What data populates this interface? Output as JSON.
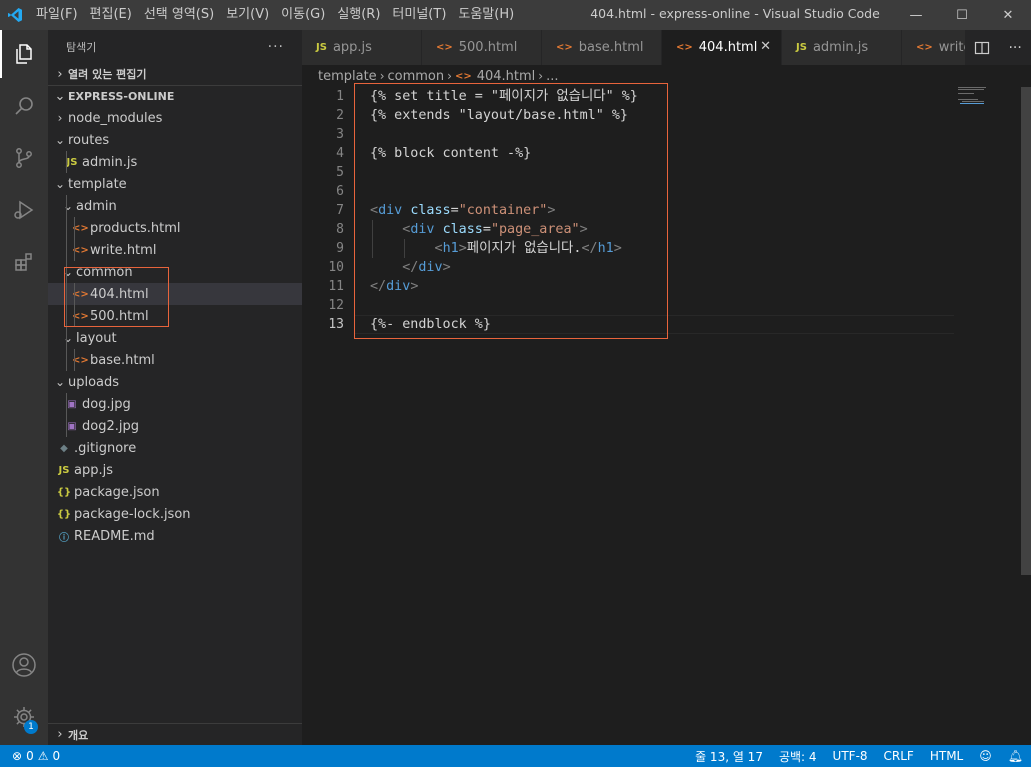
{
  "window": {
    "title": "404.html - express-online - Visual Studio Code",
    "menu": [
      "파일(F)",
      "편집(E)",
      "선택 영역(S)",
      "보기(V)",
      "이동(G)",
      "실행(R)",
      "터미널(T)",
      "도움말(H)"
    ],
    "controls": {
      "minimize": "—",
      "maximize": "☐",
      "close": "✕"
    }
  },
  "activity_bar": {
    "icons": [
      "files-icon",
      "search-icon",
      "source-control-icon",
      "run-debug-icon",
      "extensions-icon",
      "account-icon",
      "settings-icon"
    ],
    "settings_badge": "1"
  },
  "explorer": {
    "header": "탐색기",
    "more": "···",
    "open_editors": "열려 있는 편집기",
    "workspace": "EXPRESS-ONLINE",
    "outline": "개요",
    "tree": [
      {
        "label": "node_modules",
        "kind": "folder",
        "expanded": false
      },
      {
        "label": "routes",
        "kind": "folder",
        "expanded": true
      },
      {
        "label": "admin.js",
        "kind": "js"
      },
      {
        "label": "template",
        "kind": "folder",
        "expanded": true
      },
      {
        "label": "admin",
        "kind": "folder",
        "expanded": true
      },
      {
        "label": "products.html",
        "kind": "html"
      },
      {
        "label": "write.html",
        "kind": "html"
      },
      {
        "label": "common",
        "kind": "folder",
        "expanded": true
      },
      {
        "label": "404.html",
        "kind": "html",
        "active": true
      },
      {
        "label": "500.html",
        "kind": "html"
      },
      {
        "label": "layout",
        "kind": "folder",
        "expanded": true
      },
      {
        "label": "base.html",
        "kind": "html"
      },
      {
        "label": "uploads",
        "kind": "folder",
        "expanded": true
      },
      {
        "label": "dog.jpg",
        "kind": "image"
      },
      {
        "label": "dog2.jpg",
        "kind": "image"
      },
      {
        "label": ".gitignore",
        "kind": "git"
      },
      {
        "label": "app.js",
        "kind": "js"
      },
      {
        "label": "package.json",
        "kind": "json"
      },
      {
        "label": "package-lock.json",
        "kind": "json"
      },
      {
        "label": "README.md",
        "kind": "info"
      }
    ],
    "icon_glyphs": {
      "js": "JS",
      "html": "<>",
      "json": "{}",
      "image": "▣",
      "git": "◆",
      "info": "ⓘ"
    }
  },
  "tabs": [
    {
      "label": "app.js",
      "icon": "JS",
      "active": false
    },
    {
      "label": "500.html",
      "icon": "<>",
      "active": false
    },
    {
      "label": "base.html",
      "icon": "<>",
      "active": false
    },
    {
      "label": "404.html",
      "icon": "<>",
      "active": true,
      "close": "✕"
    },
    {
      "label": "admin.js",
      "icon": "JS",
      "active": false
    },
    {
      "label": "write",
      "icon": "<>",
      "active": false
    }
  ],
  "breadcrumb": {
    "parts": [
      "template",
      "common",
      "404.html",
      "..."
    ],
    "separator": "›"
  },
  "editor": {
    "line_numbers": [
      "1",
      "2",
      "3",
      "4",
      "5",
      "6",
      "7",
      "8",
      "9",
      "10",
      "11",
      "12",
      "13"
    ],
    "lines": [
      [
        {
          "t": "{% set title = \"페이지가 없습니다\" %}",
          "c": "plain"
        }
      ],
      [
        {
          "t": "{% extends \"layout/base.html\" %}",
          "c": "plain"
        }
      ],
      [
        {
          "t": "",
          "c": "plain"
        }
      ],
      [
        {
          "t": "{% block content -%}",
          "c": "plain"
        }
      ],
      [
        {
          "t": "",
          "c": "plain"
        }
      ],
      [
        {
          "t": "",
          "c": "plain"
        }
      ],
      [
        {
          "t": "<",
          "c": "br"
        },
        {
          "t": "div",
          "c": "tag"
        },
        {
          "t": " ",
          "c": "plain"
        },
        {
          "t": "class",
          "c": "attr"
        },
        {
          "t": "=",
          "c": "plain"
        },
        {
          "t": "\"container\"",
          "c": "str"
        },
        {
          "t": ">",
          "c": "br"
        }
      ],
      [
        {
          "t": "    ",
          "c": "plain"
        },
        {
          "t": "<",
          "c": "br"
        },
        {
          "t": "div",
          "c": "tag"
        },
        {
          "t": " ",
          "c": "plain"
        },
        {
          "t": "class",
          "c": "attr"
        },
        {
          "t": "=",
          "c": "plain"
        },
        {
          "t": "\"page_area\"",
          "c": "str"
        },
        {
          "t": ">",
          "c": "br"
        }
      ],
      [
        {
          "t": "        ",
          "c": "plain"
        },
        {
          "t": "<",
          "c": "br"
        },
        {
          "t": "h1",
          "c": "tag"
        },
        {
          "t": ">",
          "c": "br"
        },
        {
          "t": "페이지가 없습니다.",
          "c": "plain"
        },
        {
          "t": "</",
          "c": "br"
        },
        {
          "t": "h1",
          "c": "tag"
        },
        {
          "t": ">",
          "c": "br"
        }
      ],
      [
        {
          "t": "    ",
          "c": "plain"
        },
        {
          "t": "</",
          "c": "br"
        },
        {
          "t": "div",
          "c": "tag"
        },
        {
          "t": ">",
          "c": "br"
        }
      ],
      [
        {
          "t": "</",
          "c": "br"
        },
        {
          "t": "div",
          "c": "tag"
        },
        {
          "t": ">",
          "c": "br"
        }
      ],
      [
        {
          "t": "",
          "c": "plain"
        }
      ],
      [
        {
          "t": "{%- endblock %}",
          "c": "plain"
        }
      ]
    ],
    "current_line": 13
  },
  "status_bar": {
    "errors": "0",
    "warnings": "0",
    "position": "줄 13, 열 17",
    "spaces": "공백: 4",
    "encoding": "UTF-8",
    "eol": "CRLF",
    "language": "HTML"
  },
  "colors": {
    "accent": "#007acc",
    "highlight_box": "#e8643c",
    "js_icon": "#cbcb41",
    "html_icon": "#e37933",
    "json_icon": "#cbcb41",
    "image_icon": "#a074c4",
    "info_icon": "#519aba"
  }
}
